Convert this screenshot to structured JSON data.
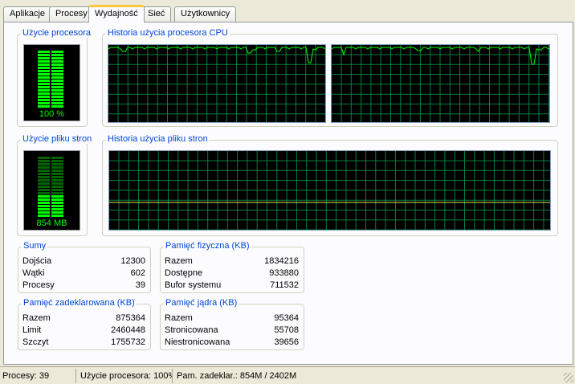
{
  "tabs": [
    "Aplikacje",
    "Procesy",
    "Wydajność",
    "Sieć",
    "Użytkownicy"
  ],
  "active_tab": "Wydajność",
  "groups": {
    "cpu_usage": {
      "title": "Użycie procesora",
      "value": "100 %"
    },
    "cpu_history": {
      "title": "Historia użycia procesora CPU"
    },
    "pf_usage": {
      "title": "Użycie pliku stron",
      "value": "854 MB"
    },
    "pf_history": {
      "title": "Historia użycia pliku stron"
    }
  },
  "totals": {
    "title": "Sumy",
    "rows": [
      {
        "label": "Dojścia",
        "value": "12300"
      },
      {
        "label": "Wątki",
        "value": "602"
      },
      {
        "label": "Procesy",
        "value": "39"
      }
    ]
  },
  "physical": {
    "title": "Pamięć fizyczna (KB)",
    "rows": [
      {
        "label": "Razem",
        "value": "1834216"
      },
      {
        "label": "Dostępne",
        "value": "933880"
      },
      {
        "label": "Bufor systemu",
        "value": "711532"
      }
    ]
  },
  "commit": {
    "title": "Pamięć zadeklarowana (KB)",
    "rows": [
      {
        "label": "Razem",
        "value": "875364"
      },
      {
        "label": "Limit",
        "value": "2460448"
      },
      {
        "label": "Szczyt",
        "value": "1755732"
      }
    ]
  },
  "kernel": {
    "title": "Pamięć jądra (KB)",
    "rows": [
      {
        "label": "Razem",
        "value": "95364"
      },
      {
        "label": "Stronicowana",
        "value": "55708"
      },
      {
        "label": "Niestronicowana",
        "value": "39656"
      }
    ]
  },
  "status": {
    "processes": "Procesy: 39",
    "cpu": "Użycie procesora: 100%",
    "commit": "Pam. zadeklar.: 854M / 2402M"
  },
  "meters": {
    "cpu_fraction": 1.0,
    "pagefile_fraction": 0.355
  },
  "colors": {
    "graph_bg": "#000000",
    "grid": "#008040",
    "line": "#00ff00",
    "title_blue": "#0046d5"
  }
}
